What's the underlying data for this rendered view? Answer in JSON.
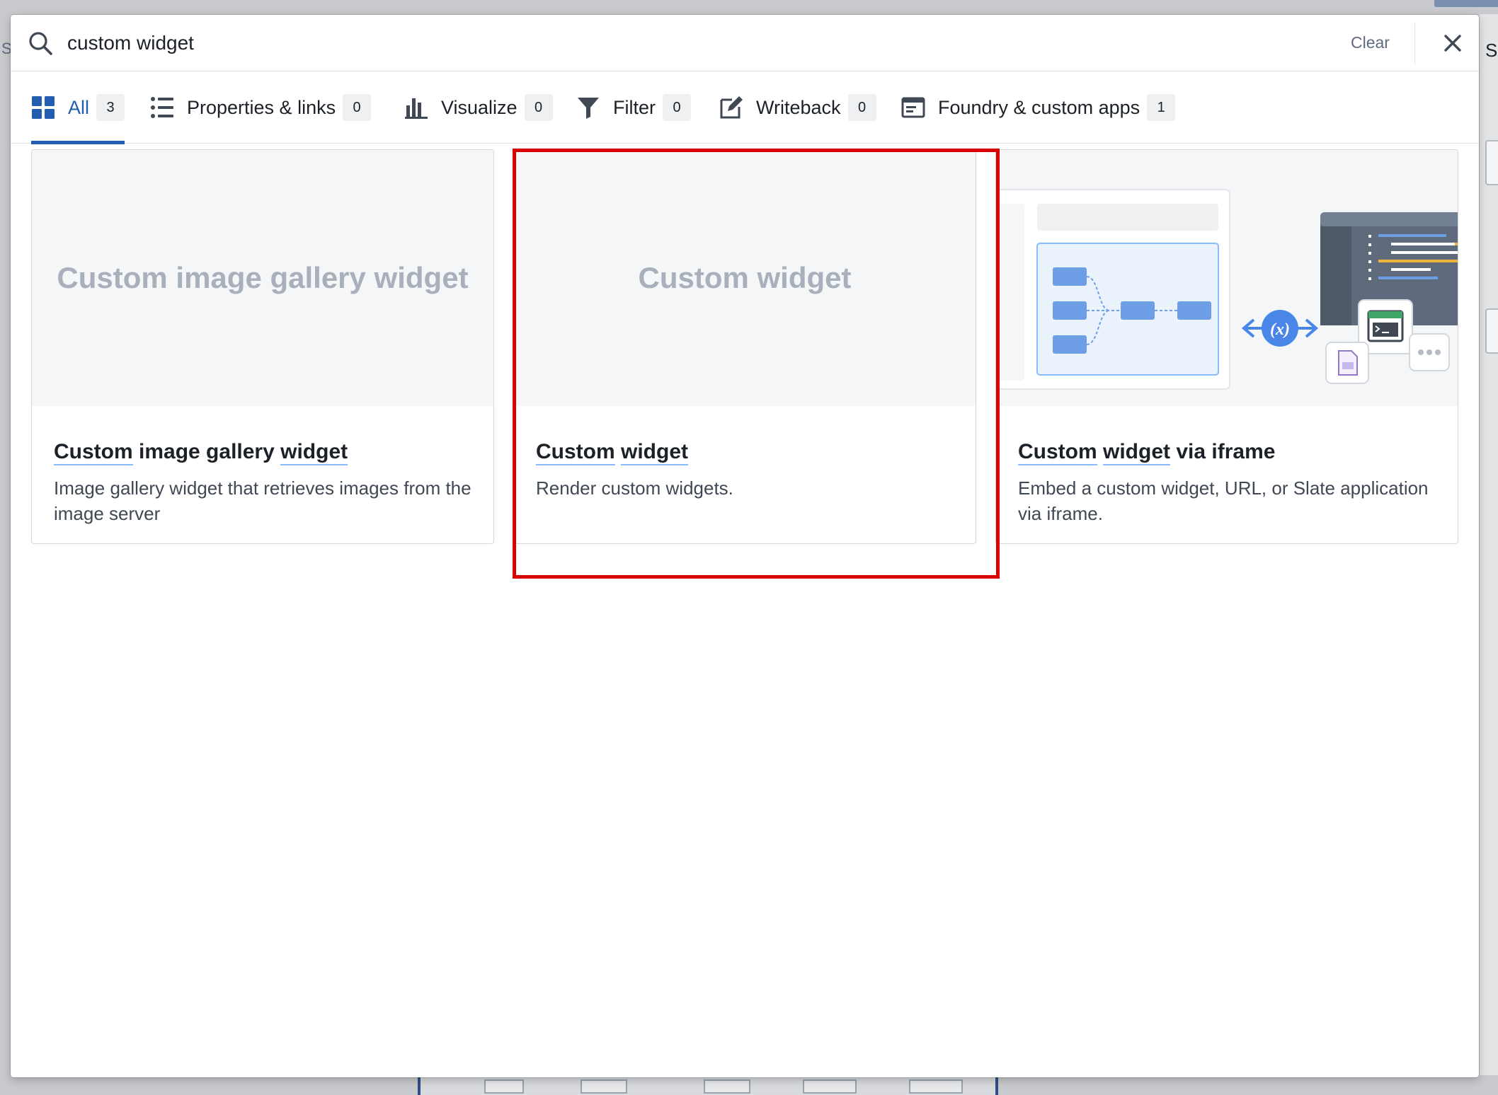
{
  "search": {
    "value": "custom widget",
    "clear_label": "Clear"
  },
  "tabs": [
    {
      "label": "All",
      "count": "3",
      "icon": "grid-icon",
      "active": true
    },
    {
      "label": "Properties & links",
      "count": "0",
      "icon": "list-icon"
    },
    {
      "label": "Visualize",
      "count": "0",
      "icon": "bar-chart-icon"
    },
    {
      "label": "Filter",
      "count": "0",
      "icon": "filter-icon"
    },
    {
      "label": "Writeback",
      "count": "0",
      "icon": "edit-icon"
    },
    {
      "label": "Foundry & custom apps",
      "count": "1",
      "icon": "application-icon"
    }
  ],
  "cards": [
    {
      "preview_text": "Custom image gallery widget",
      "title_parts": [
        "Custom",
        "image gallery",
        "widget"
      ],
      "description": "Image gallery widget that retrieves images from the image server"
    },
    {
      "preview_text": "Custom widget",
      "title_parts": [
        "Custom",
        "widget"
      ],
      "description": "Render custom widgets."
    },
    {
      "preview_text": "",
      "title_parts": [
        "Custom",
        "widget",
        "via iframe"
      ],
      "description": "Embed a custom widget, URL, or Slate application via iframe."
    }
  ],
  "illustration": {
    "variable_label": "(x)"
  },
  "background": {
    "left_letter": "S",
    "right_letter": "S"
  },
  "colors": {
    "accent": "#215db0",
    "highlight_box": "#d90000",
    "term_underline": "#8abbff",
    "illustration_blue": "#6e9fe6"
  }
}
